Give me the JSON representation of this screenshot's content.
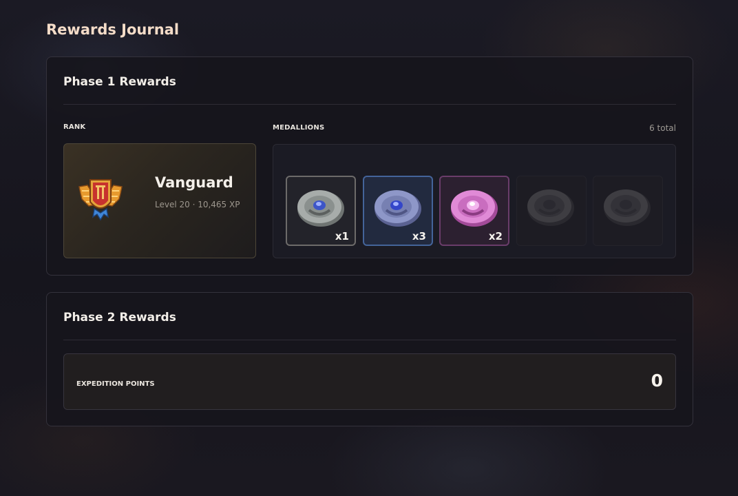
{
  "page": {
    "title": "Rewards Journal"
  },
  "phase1": {
    "title": "Phase 1 Rewards",
    "rank": {
      "section_label": "RANK",
      "name": "Vanguard",
      "detail": "Level 20 · 10,465 XP",
      "icon": "winged-shield-emblem-icon"
    },
    "medallions": {
      "section_label": "MEDALLIONS",
      "total_text": "6 total",
      "items": [
        {
          "tier": "silver",
          "count": "x1",
          "color": "#a7acaa",
          "icon": "medallion-icon",
          "locked": false
        },
        {
          "tier": "blue",
          "count": "x3",
          "color": "#8e97c8",
          "icon": "medallion-icon",
          "locked": false
        },
        {
          "tier": "pink",
          "count": "x2",
          "color": "#e08ad6",
          "icon": "medallion-icon",
          "locked": false
        },
        {
          "tier": "locked",
          "count": "",
          "color": "#3e3d42",
          "icon": "medallion-icon",
          "locked": true
        },
        {
          "tier": "locked",
          "count": "",
          "color": "#3e3d42",
          "icon": "medallion-icon",
          "locked": true
        }
      ]
    }
  },
  "phase2": {
    "title": "Phase 2 Rewards",
    "expedition_points": {
      "label": "EXPEDITION POINTS",
      "value": "0"
    }
  }
}
